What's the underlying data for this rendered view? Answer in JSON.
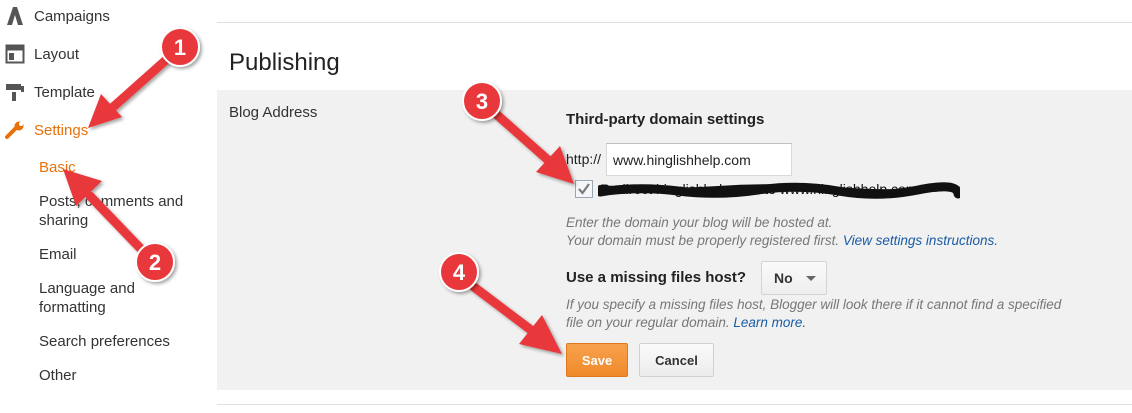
{
  "sidebar": {
    "items": [
      {
        "label": "Campaigns",
        "icon": "campaigns-icon"
      },
      {
        "label": "Layout",
        "icon": "layout-icon"
      },
      {
        "label": "Template",
        "icon": "template-icon"
      },
      {
        "label": "Settings",
        "icon": "wrench-icon"
      }
    ],
    "sub_items": [
      {
        "label": "Basic"
      },
      {
        "label": "Posts, comments and sharing"
      },
      {
        "label": "Email"
      },
      {
        "label": "Language and formatting"
      },
      {
        "label": "Search preferences"
      },
      {
        "label": "Other"
      }
    ]
  },
  "main": {
    "title": "Publishing",
    "blog_address_label": "Blog Address",
    "section_title": "Third-party domain settings",
    "http_prefix": "http://",
    "domain_value": "www.hinglishhelp.com",
    "redirect_label": "Redirect hinglishhelp.com to www.hinglishhelp.com",
    "help_line1": "Enter the domain your blog will be hosted at.",
    "help_line2": "Your domain must be properly registered first.",
    "help_link": "View settings instructions.",
    "missing_host_label": "Use a missing files host?",
    "missing_host_value": "No",
    "missing_help_line1": "If you specify a missing files host, Blogger will look there if it cannot find a specified",
    "missing_help_line2": "file on your regular domain.",
    "missing_help_link": "Learn more.",
    "save_label": "Save",
    "cancel_label": "Cancel"
  },
  "annotations": [
    "1",
    "2",
    "3",
    "4"
  ],
  "colors": {
    "accent": "#e8710a",
    "arrow": "#e8393b",
    "link": "#1a5ba6"
  }
}
